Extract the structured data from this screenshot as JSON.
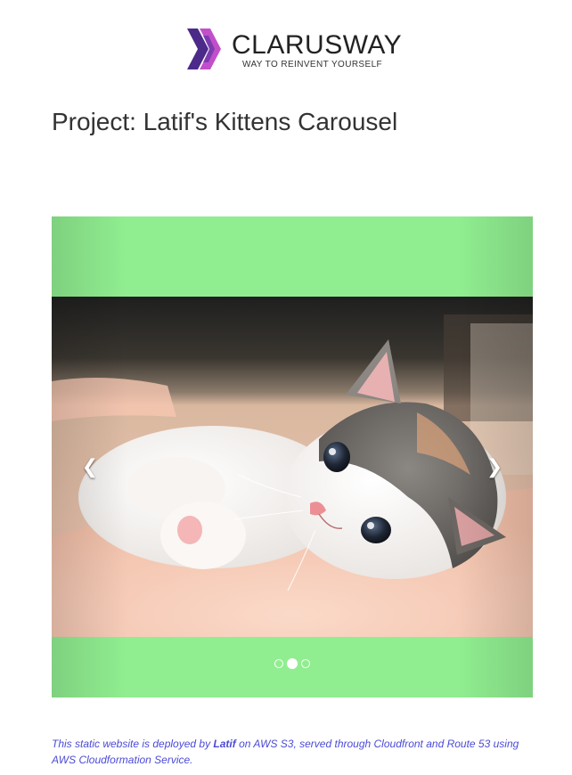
{
  "header": {
    "brand_name": "CLARUSWAY",
    "tagline": "WAY TO REINVENT YOURSELF",
    "logo_icon": "chevron-logo-icon",
    "logo_colors": [
      "#4b2a8a",
      "#c24fc9"
    ]
  },
  "page": {
    "title": "Project: Latif's Kittens Carousel"
  },
  "carousel": {
    "background_color": "#90ee90",
    "prev_icon": "chevron-left-icon",
    "next_icon": "chevron-right-icon",
    "prev_glyph": "❮",
    "next_glyph": "❯",
    "slide_count": 3,
    "active_index": 1,
    "slide_image": "kitten-photo"
  },
  "footer": {
    "text_before": "This static website is deployed by ",
    "author": "Latif",
    "text_after": " on AWS S3, served through Cloudfront and Route 53 using AWS Cloudformation Service.",
    "color": "#4b4bd6"
  }
}
